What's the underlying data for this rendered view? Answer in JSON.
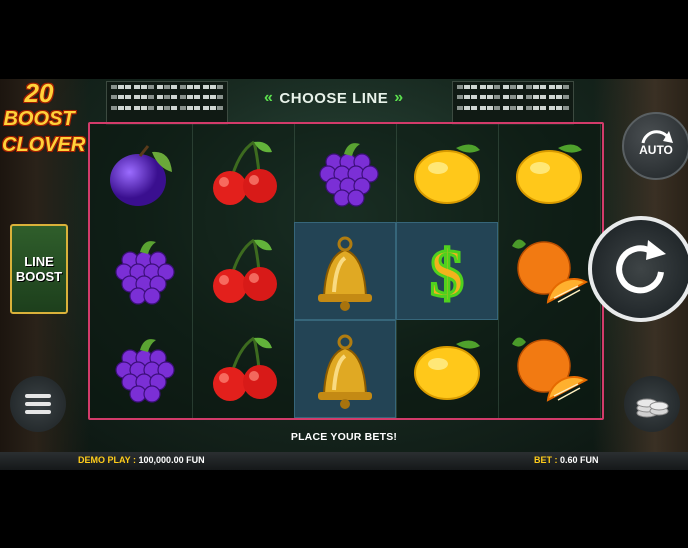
{
  "game": {
    "logo": {
      "line1": "20",
      "line2": "BOOST",
      "line3": "CLOVER"
    },
    "choose_line_label": "CHOOSE LINE",
    "line_boost": {
      "line1": "LINE",
      "line2": "BOOST"
    },
    "auto_label": "AUTO",
    "message": "PLACE YOUR BETS!",
    "balance_label": "DEMO PLAY :",
    "balance_value": "100,000.00 FUN",
    "bet_label": "BET :",
    "bet_value": "0.60 FUN"
  },
  "reels": [
    [
      "plum",
      "grapes",
      "grapes"
    ],
    [
      "cherry",
      "cherry",
      "cherry"
    ],
    [
      "grapes",
      "bell",
      "bell"
    ],
    [
      "lemon",
      "dollar",
      "lemon"
    ],
    [
      "lemon",
      "orange",
      "orange"
    ]
  ],
  "highlighted": [
    [
      2,
      1
    ],
    [
      3,
      1
    ],
    [
      2,
      2
    ]
  ],
  "colors": {
    "frame": "#d23b6a",
    "accent": "#5be04e",
    "gold": "#ffcc1a"
  }
}
